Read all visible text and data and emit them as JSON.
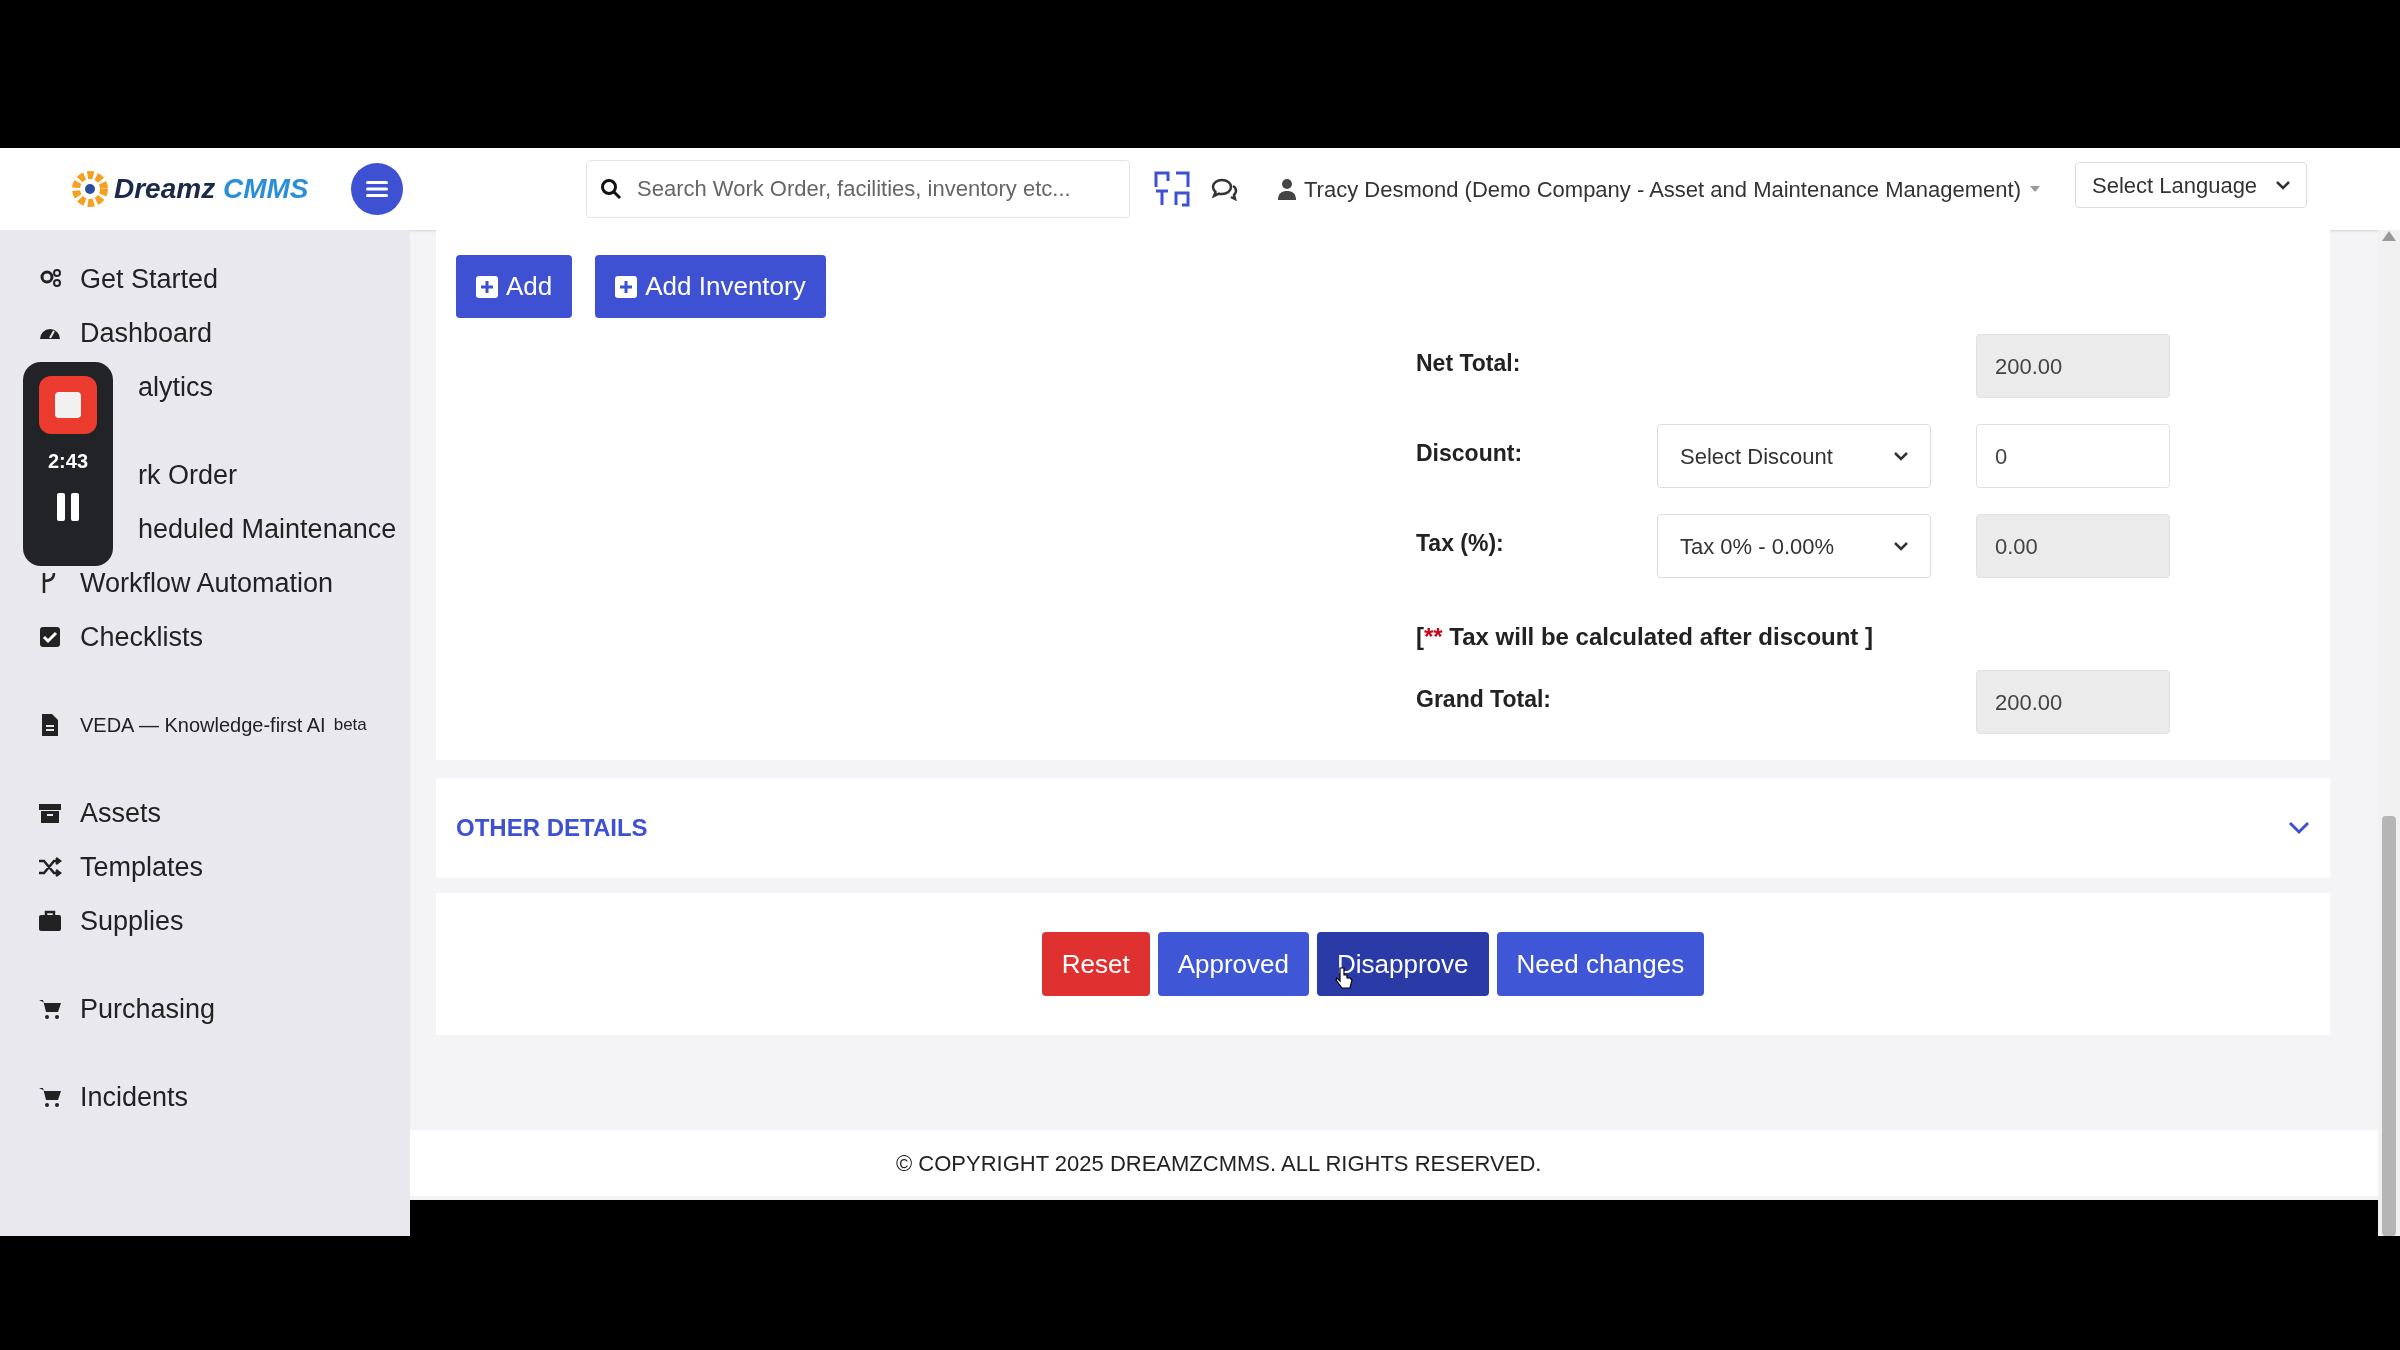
{
  "header": {
    "logo": {
      "word1": "Dreamz",
      "word2": "CMMS"
    },
    "search": {
      "placeholder": "Search Work Order, facilities, inventory etc..."
    },
    "user": "Tracy Desmond (Demo Company - Asset and Maintenance Management)",
    "language": "Select Language"
  },
  "sidebar": {
    "items": [
      {
        "label": "Get Started"
      },
      {
        "label": "Dashboard"
      },
      {
        "label": "alytics"
      },
      {
        "label": "rk Order"
      },
      {
        "label": "heduled Maintenance"
      },
      {
        "label": "Workflow Automation"
      },
      {
        "label": "Checklists"
      },
      {
        "label": "VEDA — Knowledge-first AI",
        "badge": "beta"
      },
      {
        "label": "Assets"
      },
      {
        "label": "Templates"
      },
      {
        "label": "Supplies"
      },
      {
        "label": "Purchasing"
      },
      {
        "label": "Incidents"
      }
    ]
  },
  "recorder": {
    "time": "2:43"
  },
  "top_buttons": [
    "Add",
    "Add Inventory"
  ],
  "totals": [
    {
      "kind": "value",
      "label": "Net Total:",
      "value": "200.00",
      "readonly": true
    },
    {
      "kind": "select_value",
      "label": "Discount:",
      "select": "Select Discount",
      "value": "0",
      "readonly": false
    },
    {
      "kind": "select_value",
      "label": "Tax (%):",
      "select": "Tax 0% - 0.00%",
      "value": "0.00",
      "readonly": true
    },
    {
      "kind": "note",
      "open": "[",
      "mark": "**",
      "text": "Tax will be calculated after discount ]"
    },
    {
      "kind": "value",
      "label": "Grand Total:",
      "value": "200.00",
      "readonly": true
    }
  ],
  "other_details": {
    "title": "OTHER DETAILS",
    "expanded": false
  },
  "actions": [
    {
      "label": "Reset",
      "kind": "danger",
      "hovered": false
    },
    {
      "label": "Approved",
      "kind": "primary",
      "hovered": false
    },
    {
      "label": "Disapprove",
      "kind": "primary",
      "hovered": true
    },
    {
      "label": "Need changes",
      "kind": "primary",
      "hovered": false
    }
  ],
  "footer": "© COPYRIGHT 2025 DREAMZCMMS. ALL RIGHTS RESERVED."
}
